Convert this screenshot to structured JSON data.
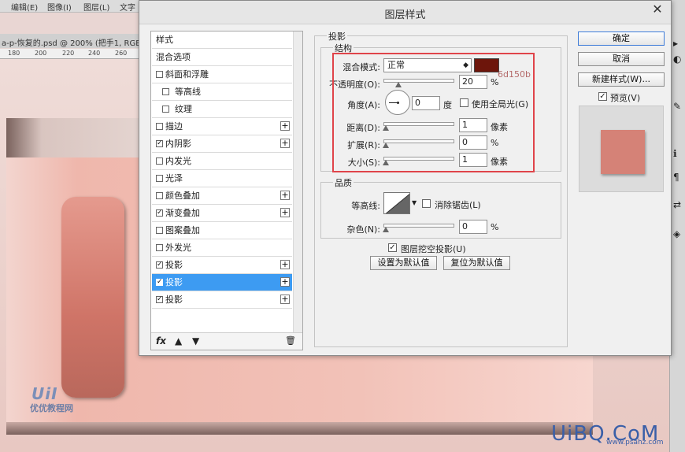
{
  "app": {
    "menu": [
      "编辑(E)",
      "图像(I)",
      "图层(L)",
      "文字"
    ],
    "doc_tab": "a-p-恢复的.psd @ 200% (把手1, RGB/",
    "ruler_ticks": [
      "180",
      "200",
      "220",
      "240",
      "260"
    ],
    "watermark_logo": "UiI",
    "watermark_text": "优优教程网",
    "watermark_site": "UiBQ.CoM",
    "watermark_site_sub": "www.psahz.com",
    "rightbar_icons": [
      "ps-tool-icon",
      "half-circle-icon",
      "brush-icon",
      "info-icon",
      "paragraph-icon",
      "swap-icon",
      "layers-icon"
    ]
  },
  "dialog": {
    "title": "图层样式",
    "close_label": "✕",
    "styles_list": {
      "items": [
        {
          "label": "样式",
          "checkbox": false,
          "checked": false,
          "plus": false
        },
        {
          "label": "混合选项",
          "checkbox": false,
          "checked": false,
          "plus": false
        },
        {
          "label": "斜面和浮雕",
          "checkbox": true,
          "checked": false,
          "plus": false
        },
        {
          "label": "等高线",
          "checkbox": true,
          "checked": false,
          "plus": false,
          "indent": true
        },
        {
          "label": "纹理",
          "checkbox": true,
          "checked": false,
          "plus": false,
          "indent": true
        },
        {
          "label": "描边",
          "checkbox": true,
          "checked": false,
          "plus": true
        },
        {
          "label": "内阴影",
          "checkbox": true,
          "checked": true,
          "plus": true
        },
        {
          "label": "内发光",
          "checkbox": true,
          "checked": false,
          "plus": false
        },
        {
          "label": "光泽",
          "checkbox": true,
          "checked": false,
          "plus": false
        },
        {
          "label": "颜色叠加",
          "checkbox": true,
          "checked": false,
          "plus": true
        },
        {
          "label": "渐变叠加",
          "checkbox": true,
          "checked": true,
          "plus": true
        },
        {
          "label": "图案叠加",
          "checkbox": true,
          "checked": false,
          "plus": false
        },
        {
          "label": "外发光",
          "checkbox": true,
          "checked": false,
          "plus": false
        },
        {
          "label": "投影",
          "checkbox": true,
          "checked": true,
          "plus": true
        },
        {
          "label": "投影",
          "checkbox": true,
          "checked": true,
          "plus": true,
          "selected": true
        },
        {
          "label": "投影",
          "checkbox": true,
          "checked": true,
          "plus": true
        }
      ],
      "footer": [
        "fx",
        "▲",
        "▼",
        "🗑"
      ]
    },
    "drop_shadow": {
      "section_title": "投影",
      "structure": {
        "title": "结构",
        "blend_mode_label": "混合模式:",
        "blend_mode_value": "正常",
        "color": "#6d150b",
        "color_note": "6d150b",
        "opacity_label": "不透明度(O):",
        "opacity_value": "20",
        "opacity_unit": "%",
        "angle_label": "角度(A):",
        "angle_value": "0",
        "angle_unit": "度",
        "global_light_label": "使用全局光(G)",
        "distance_label": "距离(D):",
        "distance_value": "1",
        "distance_unit": "像素",
        "spread_label": "扩展(R):",
        "spread_value": "0",
        "spread_unit": "%",
        "size_label": "大小(S):",
        "size_value": "1",
        "size_unit": "像素"
      },
      "quality": {
        "title": "品质",
        "contour_label": "等高线:",
        "antialias_label": "消除锯齿(L)",
        "noise_label": "杂色(N):",
        "noise_value": "0",
        "noise_unit": "%"
      },
      "knockout_label": "图层挖空投影(U)",
      "make_default_label": "设置为默认值",
      "reset_default_label": "复位为默认值"
    },
    "buttons": {
      "ok": "确定",
      "cancel": "取消",
      "new_style": "新建样式(W)...",
      "preview_label": "预览(V)"
    }
  }
}
